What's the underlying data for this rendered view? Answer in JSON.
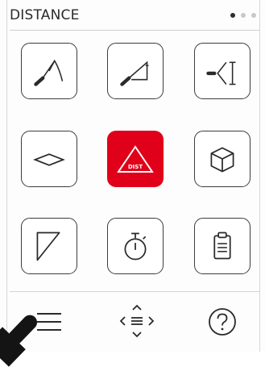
{
  "header": {
    "title": "DISTANCE",
    "pages": [
      {
        "state": "active",
        "color": "#2e2e2e"
      },
      {
        "state": "inactive",
        "color": "#c8c8c8"
      },
      {
        "state": "inactive",
        "color": "#c8c8c8"
      }
    ]
  },
  "tiles": [
    {
      "icon": "indirect-distance-icon",
      "selected": false
    },
    {
      "icon": "height-measure-icon",
      "selected": false
    },
    {
      "icon": "stakeout-distance-icon",
      "selected": false
    },
    {
      "icon": "area-icon",
      "selected": false
    },
    {
      "icon": "dist-warning-icon",
      "label": "DIST",
      "selected": true
    },
    {
      "icon": "volume-cube-icon",
      "selected": false
    },
    {
      "icon": "triangle-angle-icon",
      "selected": false
    },
    {
      "icon": "timer-icon",
      "selected": false
    },
    {
      "icon": "clipboard-memory-icon",
      "selected": false
    }
  ],
  "bottom_bar": [
    {
      "icon": "menu-icon"
    },
    {
      "icon": "navigate-arrows-icon"
    },
    {
      "icon": "help-icon"
    }
  ],
  "colors": {
    "accent": "#e0001a",
    "icon_stroke": "#2a2a2a",
    "tile_border": "#3c3c3c"
  }
}
